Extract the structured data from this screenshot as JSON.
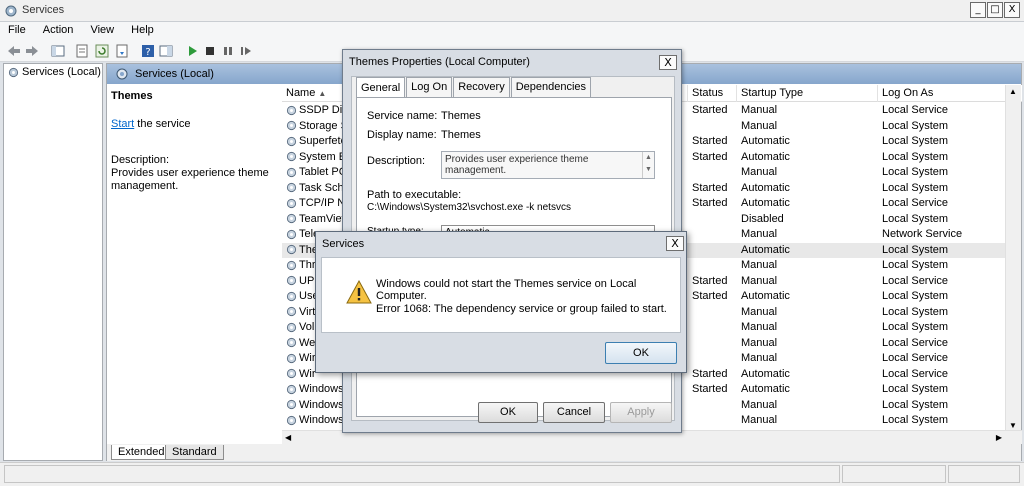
{
  "window": {
    "title": "Services",
    "minimize": "_",
    "maximize": "□",
    "close": "X"
  },
  "menu": [
    "File",
    "Action",
    "View",
    "Help"
  ],
  "tree": {
    "root": "Services (Local)"
  },
  "panel": {
    "header": "Services (Local)",
    "selected_name": "Themes",
    "start_link": "Start",
    "start_suffix": " the service",
    "description_label": "Description:",
    "description_text": "Provides user experience theme management."
  },
  "columns": {
    "name": "Name",
    "status": "Status",
    "startup_type": "Startup Type",
    "log_on_as": "Log On As",
    "sort_glyph": "▲"
  },
  "services": [
    {
      "name": "SSDP Disc",
      "status": "Started",
      "startup": "Manual",
      "logon": "Local Service"
    },
    {
      "name": "Storage Se",
      "status": "",
      "startup": "Manual",
      "logon": "Local System"
    },
    {
      "name": "Superfetc",
      "status": "Started",
      "startup": "Automatic",
      "logon": "Local System"
    },
    {
      "name": "System Ev",
      "status": "Started",
      "startup": "Automatic",
      "logon": "Local System"
    },
    {
      "name": "Tablet PC",
      "status": "",
      "startup": "Manual",
      "logon": "Local System"
    },
    {
      "name": "Task Sche",
      "status": "Started",
      "startup": "Automatic",
      "logon": "Local System"
    },
    {
      "name": "TCP/IP Ne",
      "status": "Started",
      "startup": "Automatic",
      "logon": "Local Service"
    },
    {
      "name": "TeamView",
      "status": "",
      "startup": "Disabled",
      "logon": "Local System"
    },
    {
      "name": "Tele",
      "status": "",
      "startup": "Manual",
      "logon": "Network Service"
    },
    {
      "name": "The",
      "status": "",
      "startup": "Automatic",
      "logon": "Local System",
      "selected": true
    },
    {
      "name": "Thr",
      "status": "",
      "startup": "Manual",
      "logon": "Local System"
    },
    {
      "name": "UPr",
      "status": "Started",
      "startup": "Manual",
      "logon": "Local Service"
    },
    {
      "name": "Use",
      "status": "Started",
      "startup": "Automatic",
      "logon": "Local System"
    },
    {
      "name": "Virt",
      "status": "",
      "startup": "Manual",
      "logon": "Local System"
    },
    {
      "name": "Vol",
      "status": "",
      "startup": "Manual",
      "logon": "Local System"
    },
    {
      "name": "Wel",
      "status": "",
      "startup": "Manual",
      "logon": "Local Service"
    },
    {
      "name": "Wir",
      "status": "",
      "startup": "Manual",
      "logon": "Local Service"
    },
    {
      "name": "Wir",
      "status": "Started",
      "startup": "Automatic",
      "logon": "Local Service"
    },
    {
      "name": "Windows",
      "status": "Started",
      "startup": "Automatic",
      "logon": "Local System"
    },
    {
      "name": "Windows",
      "status": "",
      "startup": "Manual",
      "logon": "Local System"
    },
    {
      "name": "Windows",
      "status": "",
      "startup": "Manual",
      "logon": "Local System"
    }
  ],
  "bottom_tabs": {
    "extended": "Extended",
    "standard": "Standard"
  },
  "properties": {
    "title": "Themes Properties (Local Computer)",
    "close": "X",
    "tabs": [
      "General",
      "Log On",
      "Recovery",
      "Dependencies"
    ],
    "service_name_label": "Service name:",
    "service_name": "Themes",
    "display_name_label": "Display name:",
    "display_name": "Themes",
    "description_label": "Description:",
    "description": "Provides user experience theme management.",
    "path_label": "Path to executable:",
    "path": "C:\\Windows\\System32\\svchost.exe -k netsvcs",
    "startup_type_label": "Startup type:",
    "startup_type": "Automatic",
    "ok": "OK",
    "cancel": "Cancel",
    "apply": "Apply"
  },
  "error_dialog": {
    "title": "Services",
    "close": "X",
    "message": "Windows could not start the Themes service on Local Computer.",
    "error": "Error 1068: The dependency service or group failed to start.",
    "ok": "OK"
  }
}
